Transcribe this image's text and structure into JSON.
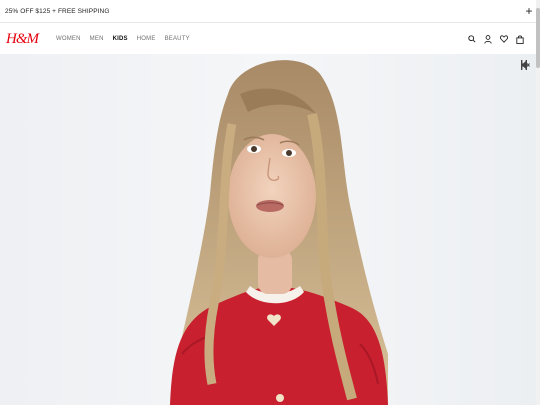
{
  "promo": {
    "text": "25% OFF $125 + FREE SHIPPING",
    "close_icon": "plus-icon"
  },
  "header": {
    "logo": "H&M",
    "nav": [
      {
        "label": "WOMEN",
        "active": false
      },
      {
        "label": "MEN",
        "active": false
      },
      {
        "label": "KIDS",
        "active": true
      },
      {
        "label": "HOME",
        "active": false
      },
      {
        "label": "BEAUTY",
        "active": false
      }
    ],
    "icons": [
      "search-icon",
      "account-icon",
      "favorites-icon",
      "bag-icon"
    ]
  },
  "hero": {
    "controls": [
      "pause-icon",
      "mute-icon"
    ]
  },
  "colors": {
    "brand": "#e50010",
    "sweater": "#c8202e",
    "background": "#f0f2f4"
  }
}
